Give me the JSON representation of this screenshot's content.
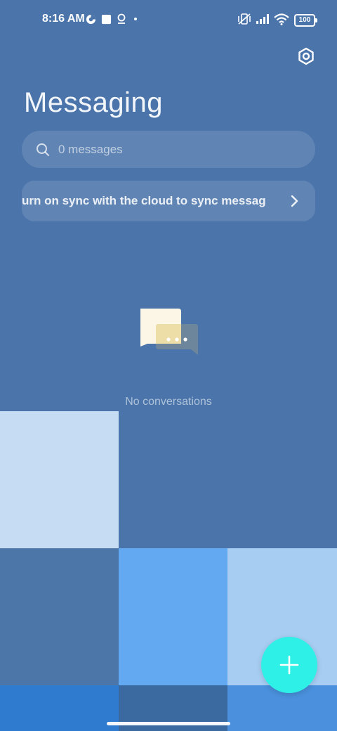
{
  "status_bar": {
    "time": "8:16 AM",
    "battery": "100",
    "icons": [
      "data-saver-icon",
      "square-notification-icon",
      "location-pin-icon",
      "dot-icon",
      "vibrate-off-icon",
      "signal-icon",
      "wifi-icon",
      "battery-icon"
    ]
  },
  "header": {
    "title": "Messaging",
    "settings_icon": "settings-icon"
  },
  "search": {
    "placeholder": "0 messages",
    "icon": "search-icon"
  },
  "sync_banner": {
    "text": "urn on sync with the cloud to sync messag",
    "icon": "chevron-right-icon"
  },
  "empty_state": {
    "text": "No conversations",
    "icon": "chat-bubbles-icon"
  },
  "fab": {
    "icon": "plus-icon"
  },
  "colors": {
    "background": "#4b75aa",
    "fab": "#2ef0e6"
  }
}
